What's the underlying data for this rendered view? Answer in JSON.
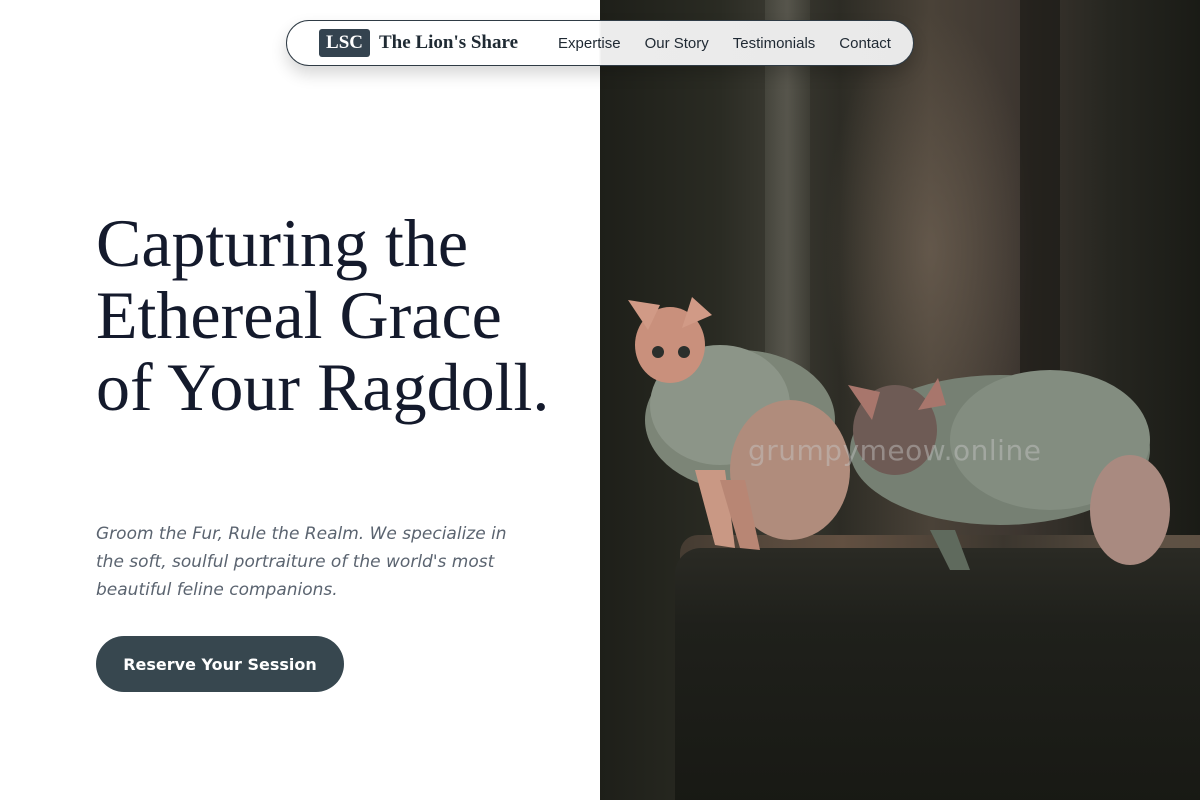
{
  "nav": {
    "logo_badge": "LSC",
    "brand": "The Lion's Share",
    "links": [
      "Expertise",
      "Our Story",
      "Testimonials",
      "Contact"
    ]
  },
  "hero": {
    "title": "Capturing the Ethereal Grace of Your Ragdoll.",
    "subtitle": "Groom the Fur, Rule the Realm. We specialize in the soft, soulful portraiture of the world's most beautiful feline companions.",
    "cta_label": "Reserve Your Session"
  },
  "photo": {
    "watermark": "grumpymeow.online"
  },
  "colors": {
    "accent": "#37474f",
    "heading": "#141a2c",
    "subtitle": "#5b6470"
  }
}
